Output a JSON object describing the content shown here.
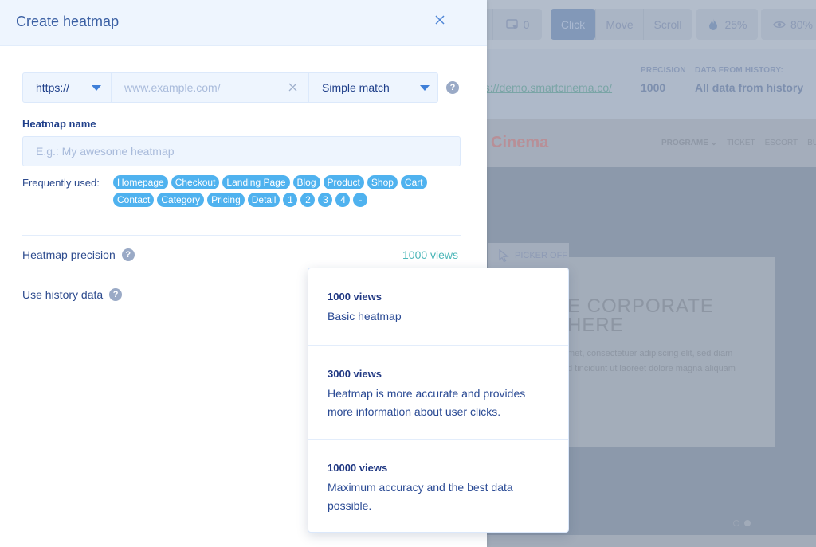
{
  "modal": {
    "title": "Create heatmap",
    "close_icon": "close-icon",
    "url_row": {
      "protocol": "https://",
      "url_placeholder": "www.example.com/",
      "url_value": "",
      "match_type": "Simple match",
      "help_glyph": "?"
    },
    "heatmap_name": {
      "label": "Heatmap name",
      "placeholder": "E.g.: My awesome heatmap",
      "value": ""
    },
    "frequently_used": {
      "label": "Frequently used:",
      "tags": [
        "Homepage",
        "Checkout",
        "Landing Page",
        "Blog",
        "Product",
        "Shop",
        "Cart",
        "Contact",
        "Category",
        "Pricing",
        "Detail",
        "1",
        "2",
        "3",
        "4",
        "-"
      ]
    },
    "precision": {
      "label": "Heatmap precision",
      "value": "1000 views"
    },
    "history": {
      "label": "Use history data"
    },
    "precision_dropdown": [
      {
        "title": "1000 views",
        "description": "Basic heatmap"
      },
      {
        "title": "3000 views",
        "description": "Heatmap is more accurate and provides more information about user clicks."
      },
      {
        "title": "10000 views",
        "description": "Maximum accuracy and the best data possible."
      }
    ]
  },
  "background": {
    "toolbar": {
      "partial_count": "0",
      "screenshot_count": "0",
      "modes": [
        "Click",
        "Move",
        "Scroll"
      ],
      "active_mode": "Click",
      "intensity": "25%",
      "opacity": "80%"
    },
    "info": {
      "url": "ps://demo.smartcinema.co/",
      "precision_label": "PRECISION",
      "precision_value": "1000",
      "history_label": "DATA FROM HISTORY:",
      "history_value": "All data from history"
    },
    "site": {
      "logo": "Cinema",
      "nav": [
        "PROGRAME ⌄",
        "TICKET",
        "ESCORT",
        "BUY F"
      ],
      "picker": "PICKER OFF",
      "hero_title": "E CORPORATE\nHERE",
      "hero_text": "met, consectetuer adipiscing elit, sed diam\nd tincidunt ut laoreet dolore magna aliquam"
    }
  },
  "colors": {
    "accent": "#3f7fd8",
    "tag": "#4fb2ef",
    "link": "#4bb6b8",
    "text_primary": "#1f3f8a",
    "header_bg": "#eef5fe"
  }
}
